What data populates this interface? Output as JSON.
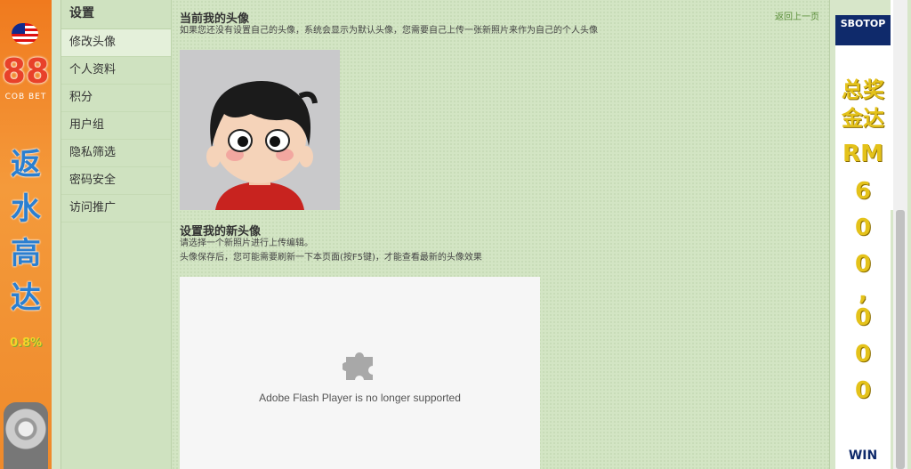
{
  "sidebar": {
    "title": "设置",
    "items": [
      {
        "label": "修改头像",
        "active": true
      },
      {
        "label": "个人资料"
      },
      {
        "label": "积分"
      },
      {
        "label": "用户组"
      },
      {
        "label": "隐私筛选"
      },
      {
        "label": "密码安全"
      },
      {
        "label": "访问推广"
      }
    ]
  },
  "content": {
    "current_avatar_title": "当前我的头像",
    "back_link": "返回上一页",
    "current_avatar_note": "如果您还没有设置自己的头像，系统会显示为默认头像，您需要自己上传一张新照片来作为自己的个人头像",
    "new_avatar_title": "设置我的新头像",
    "new_avatar_note1": "请选择一个新照片进行上传编辑。",
    "new_avatar_note2": "头像保存后，您可能需要刷新一下本页面(按F5键)，才能查看最新的头像效果",
    "flash_message": "Adobe Flash Player is no longer supported"
  },
  "ad_left": {
    "logo": "88",
    "logo_sub": "COB BET",
    "text": [
      "返",
      "水",
      "高",
      "达"
    ],
    "percent": "0.8%"
  },
  "ad_right": {
    "brand": "SBOTOP",
    "text1": "总奖",
    "text2": "金达",
    "amount": [
      "RM",
      "6",
      "0",
      "0",
      ",",
      "0",
      "0",
      "0"
    ],
    "win": "WIN"
  },
  "colors": {
    "accent_green": "#5b8f3a",
    "page_bg": "#d3e5c4",
    "sidebar_active": "#e4f0da"
  }
}
